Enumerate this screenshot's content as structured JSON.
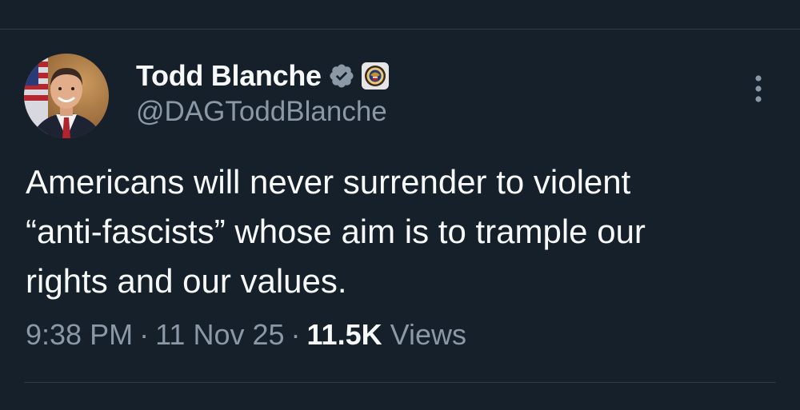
{
  "tweet": {
    "author": {
      "display_name": "Todd Blanche",
      "handle": "@DAGToddBlanche",
      "verified": true,
      "avatar_icon": "profile-photo",
      "affiliate_badge_icon": "doj-seal-icon"
    },
    "text": "Americans will never surrender to violent\n“anti-fascists” whose aim is to trample our\nrights and our values.",
    "time": "9:38 PM",
    "separator": "·",
    "date": "11 Nov 25",
    "views_count": "11.5K",
    "views_label": "Views",
    "more_icon": "more-vertical-icon"
  },
  "colors": {
    "background": "#15202b",
    "primary_text": "#f7f9f9",
    "secondary_text": "#8b98a5",
    "verified_badge": "#8b98a5",
    "divider": "#2f3b47"
  }
}
